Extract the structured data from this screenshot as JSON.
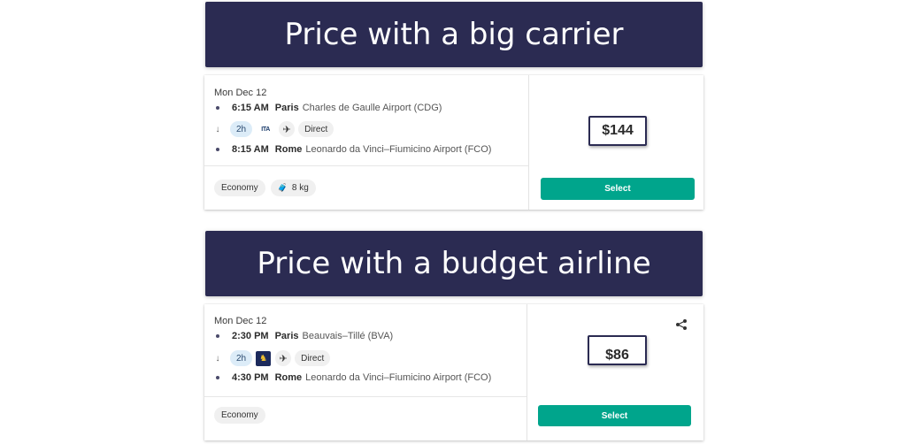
{
  "banners": {
    "top": "Price with a big carrier",
    "bottom": "Price with a budget airline"
  },
  "flights": [
    {
      "date": "Mon Dec 12",
      "depart_time": "6:15 AM",
      "depart_city": "Paris",
      "depart_airport": "Charles de Gaulle Airport (CDG)",
      "duration": "2h",
      "airline_logo_text": "ITA",
      "stops": "Direct",
      "arrive_time": "8:15 AM",
      "arrive_city": "Rome",
      "arrive_airport": "Leonardo da Vinci–Fiumicino Airport (FCO)",
      "cabin": "Economy",
      "baggage": "8 kg",
      "price": "$144",
      "select_label": "Select"
    },
    {
      "date": "Mon Dec 12",
      "depart_time": "2:30 PM",
      "depart_city": "Paris",
      "depart_airport": "Beauvais–Tillé (BVA)",
      "duration": "2h",
      "stops": "Direct",
      "arrive_time": "4:30 PM",
      "arrive_city": "Rome",
      "arrive_airport": "Leonardo da Vinci–Fiumicino Airport (FCO)",
      "cabin": "Economy",
      "price": "$86",
      "select_label": "Select"
    }
  ],
  "colors": {
    "banner": "#2b2b52",
    "select_button": "#00a58c",
    "duration_pill": "#dcecf8"
  },
  "icons": {
    "plane": "plane-icon",
    "bag": "baggage-icon",
    "share": "share-icon",
    "arrow": "arrow-down-icon"
  }
}
